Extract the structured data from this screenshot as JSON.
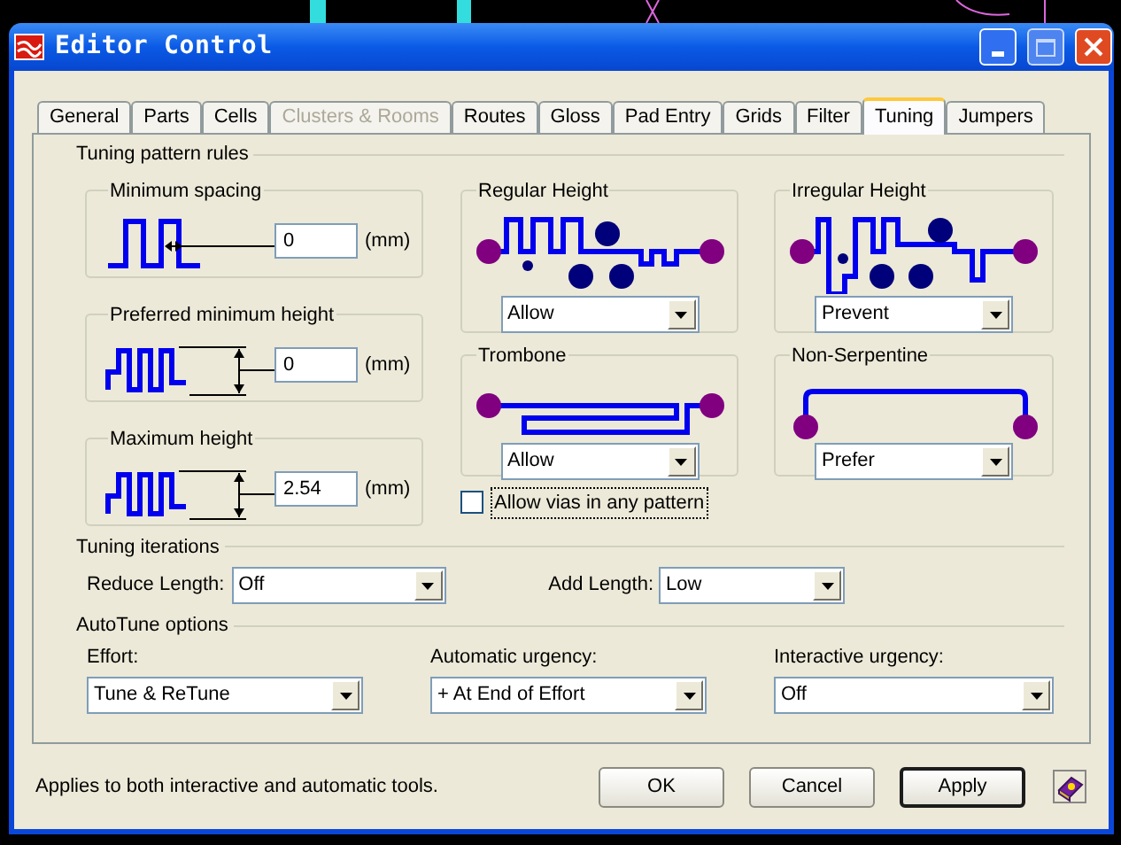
{
  "window": {
    "title": "Editor Control"
  },
  "tabs": [
    {
      "label": "General",
      "selected": false,
      "disabled": false
    },
    {
      "label": "Parts",
      "selected": false,
      "disabled": false
    },
    {
      "label": "Cells",
      "selected": false,
      "disabled": false
    },
    {
      "label": "Clusters & Rooms",
      "selected": false,
      "disabled": true
    },
    {
      "label": "Routes",
      "selected": false,
      "disabled": false
    },
    {
      "label": "Gloss",
      "selected": false,
      "disabled": false
    },
    {
      "label": "Pad Entry",
      "selected": false,
      "disabled": false
    },
    {
      "label": "Grids",
      "selected": false,
      "disabled": false
    },
    {
      "label": "Filter",
      "selected": false,
      "disabled": false
    },
    {
      "label": "Tuning",
      "selected": true,
      "disabled": false
    },
    {
      "label": "Jumpers",
      "selected": false,
      "disabled": false
    }
  ],
  "pattern_rules": {
    "title": "Tuning pattern rules",
    "limits": [
      {
        "kind": "spacing",
        "label": "Minimum spacing",
        "value": "0",
        "unit": "(mm)"
      },
      {
        "kind": "height",
        "label": "Preferred minimum height",
        "value": "0",
        "unit": "(mm)"
      },
      {
        "kind": "height",
        "label": "Maximum height",
        "value": "2.54",
        "unit": "(mm)"
      }
    ],
    "patterns": [
      {
        "kind": "regular",
        "title": "Regular Height",
        "value": "Allow"
      },
      {
        "kind": "trombone",
        "title": "Trombone",
        "value": "Allow"
      },
      {
        "kind": "irregular",
        "title": "Irregular Height",
        "value": "Prevent"
      },
      {
        "kind": "nonserpentine",
        "title": "Non-Serpentine",
        "value": "Prefer"
      }
    ],
    "allow_vias": {
      "label": "Allow vias in any pattern",
      "checked": false
    }
  },
  "iterations": {
    "title": "Tuning iterations",
    "fields": [
      {
        "label": "Reduce Length:",
        "value": "Off"
      },
      {
        "label": "Add Length:",
        "value": "Low"
      }
    ]
  },
  "autotune": {
    "title": "AutoTune options",
    "fields": [
      {
        "label": "Effort:",
        "value": "Tune & ReTune"
      },
      {
        "label": "Automatic urgency:",
        "value": "+ At End of Effort"
      },
      {
        "label": "Interactive urgency:",
        "value": "Off"
      }
    ]
  },
  "status": "Applies to both interactive and automatic tools.",
  "buttons": [
    {
      "label": "OK",
      "default": false
    },
    {
      "label": "Cancel",
      "default": false
    },
    {
      "label": "Apply",
      "default": true
    }
  ]
}
